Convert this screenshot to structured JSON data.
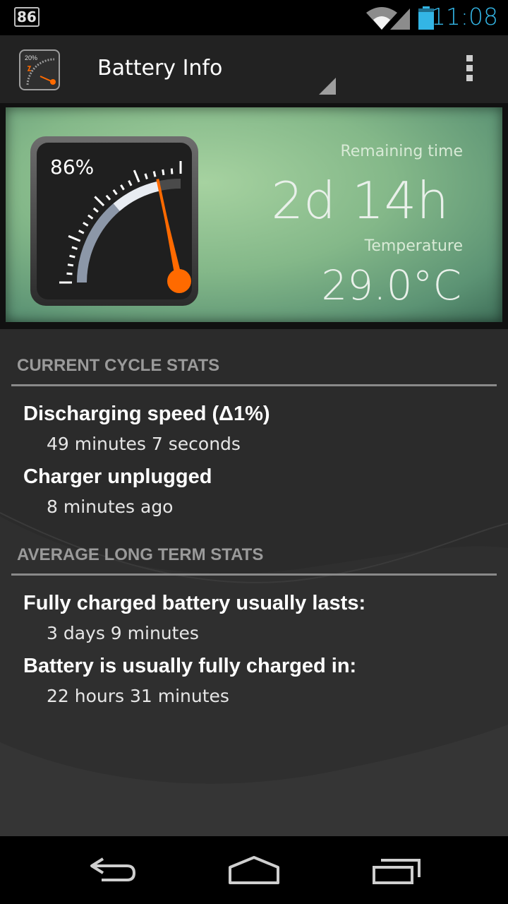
{
  "status_bar": {
    "notification_badge": "86",
    "time": "11:08",
    "icons": [
      "wifi-icon",
      "signal-icon",
      "battery-icon"
    ]
  },
  "action_bar": {
    "title": "Battery Info",
    "app_icon": {
      "name": "gauge-app-icon",
      "text": "20%"
    },
    "overflow_icon": "overflow-menu-icon"
  },
  "panel": {
    "battery_level_percent": 86,
    "gauge_label": "86%",
    "remaining_label": "Remaining time",
    "remaining_value": "2d 14h",
    "temperature_label": "Temperature",
    "temperature_value": "29.0°C",
    "needle_color": "#ff6a00"
  },
  "sections": [
    {
      "header": "CURRENT CYCLE STATS",
      "items": [
        {
          "title": "Discharging speed (Δ1%)",
          "value": "49 minutes 7 seconds"
        },
        {
          "title": "Charger unplugged",
          "value": "8 minutes ago"
        }
      ]
    },
    {
      "header": "AVERAGE LONG TERM STATS",
      "items": [
        {
          "title": "Fully charged battery usually lasts:",
          "value": "3 days 9 minutes"
        },
        {
          "title": "Battery is usually fully charged in:",
          "value": "22 hours 31 minutes"
        }
      ]
    }
  ],
  "nav_bar": {
    "buttons": [
      "back-icon",
      "home-icon",
      "recent-apps-icon"
    ]
  }
}
